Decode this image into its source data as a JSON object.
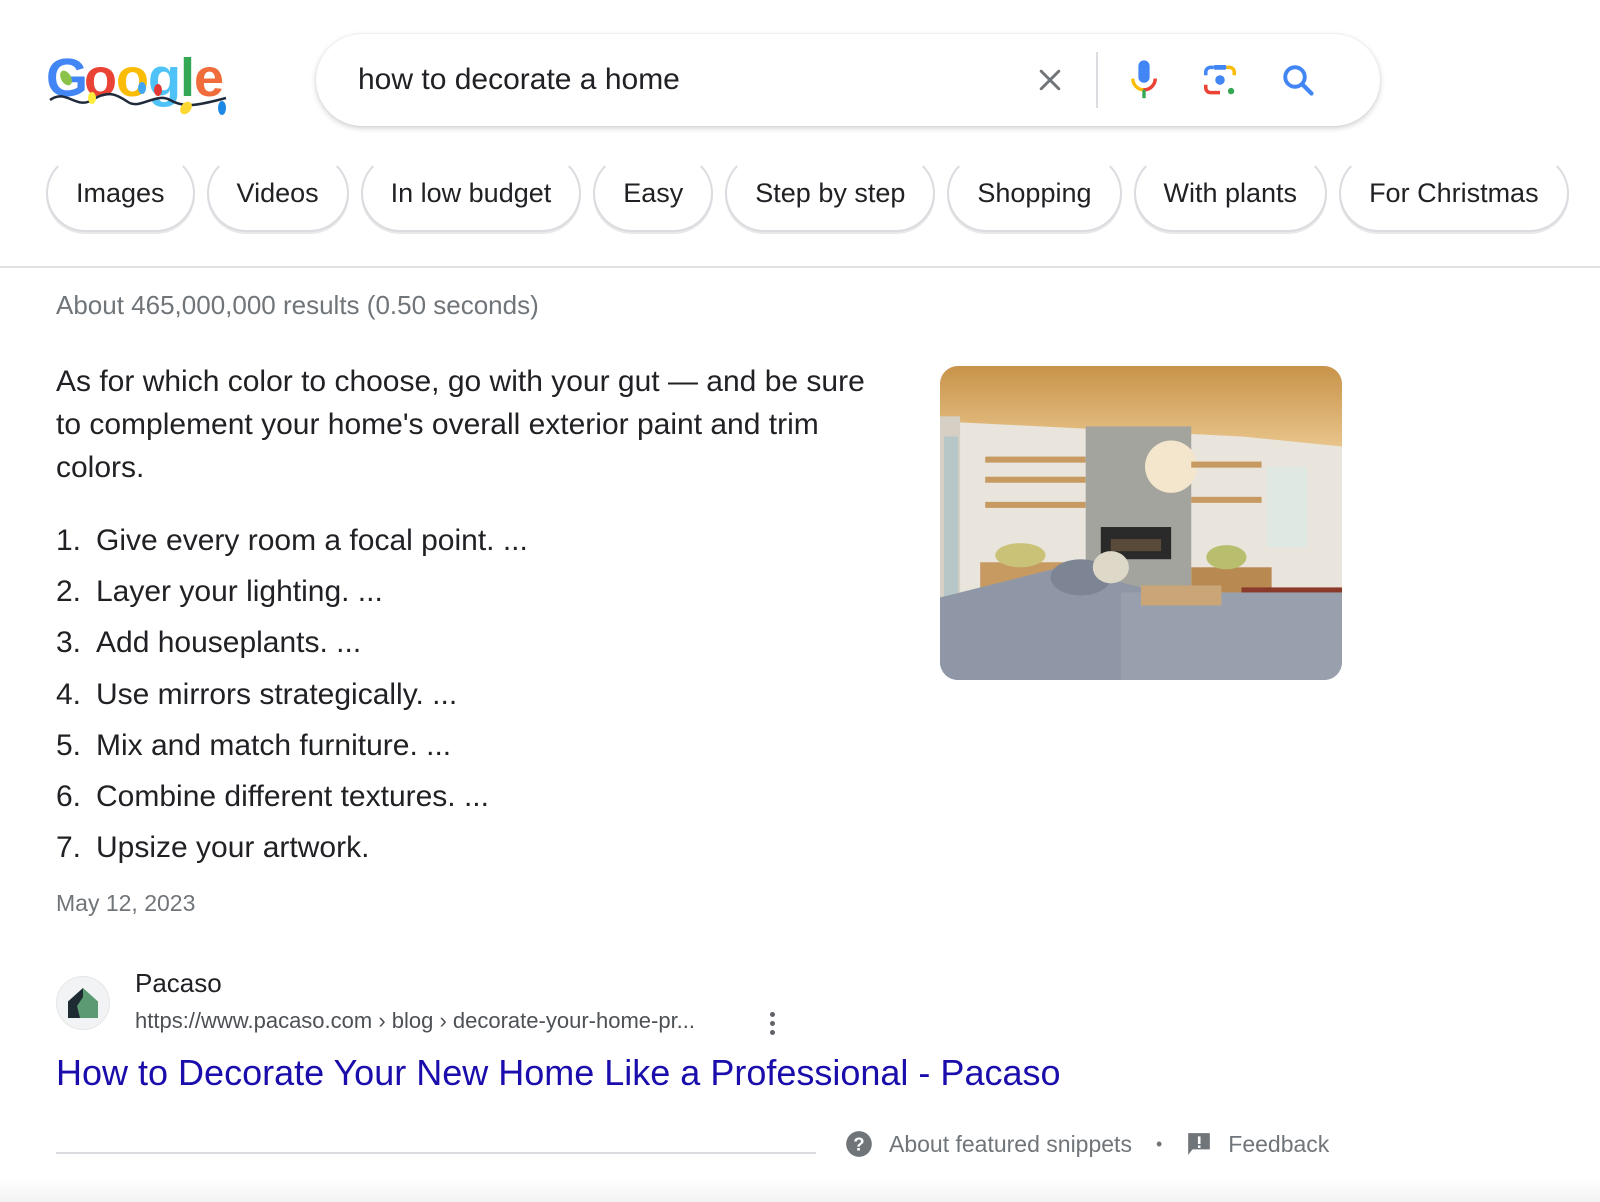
{
  "header": {
    "logo_alt": "Google",
    "search": {
      "value": "how to decorate a home",
      "clear_icon": "close-icon",
      "voice_icon": "microphone-icon",
      "lens_icon": "camera-lens-icon",
      "search_icon": "magnifier-icon"
    }
  },
  "chips": [
    {
      "label": "Images"
    },
    {
      "label": "Videos"
    },
    {
      "label": "In low budget"
    },
    {
      "label": "Easy"
    },
    {
      "label": "Step by step"
    },
    {
      "label": "Shopping"
    },
    {
      "label": "With plants"
    },
    {
      "label": "For Christmas"
    }
  ],
  "results": {
    "stats": "About 465,000,000 results (0.50 seconds)"
  },
  "featured_snippet": {
    "text": "As for which color to choose, go with your gut — and be sure to complement your home's overall exterior paint and trim colors.",
    "steps": [
      {
        "num": "1.",
        "text": "Give every room a focal point. ..."
      },
      {
        "num": "2.",
        "text": "Layer your lighting. ..."
      },
      {
        "num": "3.",
        "text": "Add houseplants. ..."
      },
      {
        "num": "4.",
        "text": "Use mirrors strategically. ..."
      },
      {
        "num": "5.",
        "text": "Mix and match furniture. ..."
      },
      {
        "num": "6.",
        "text": "Combine different textures. ..."
      },
      {
        "num": "7.",
        "text": "Upsize your artwork."
      }
    ],
    "date": "May 12, 2023",
    "image_alt": "Living room with fireplace and grey sectional sofa",
    "source": {
      "name": "Pacaso",
      "url": "https://www.pacaso.com › blog › decorate-your-home-pr...",
      "title": "How to Decorate Your New Home Like a Professional - Pacaso"
    }
  },
  "footer": {
    "about_label": "About featured snippets",
    "separator": "•",
    "feedback_label": "Feedback"
  },
  "colors": {
    "link": "#1a0dab",
    "secondary_text": "#70757a",
    "google_blue": "#4285f4",
    "google_red": "#ea4335",
    "google_yellow": "#fbbc05",
    "google_green": "#34a853"
  }
}
